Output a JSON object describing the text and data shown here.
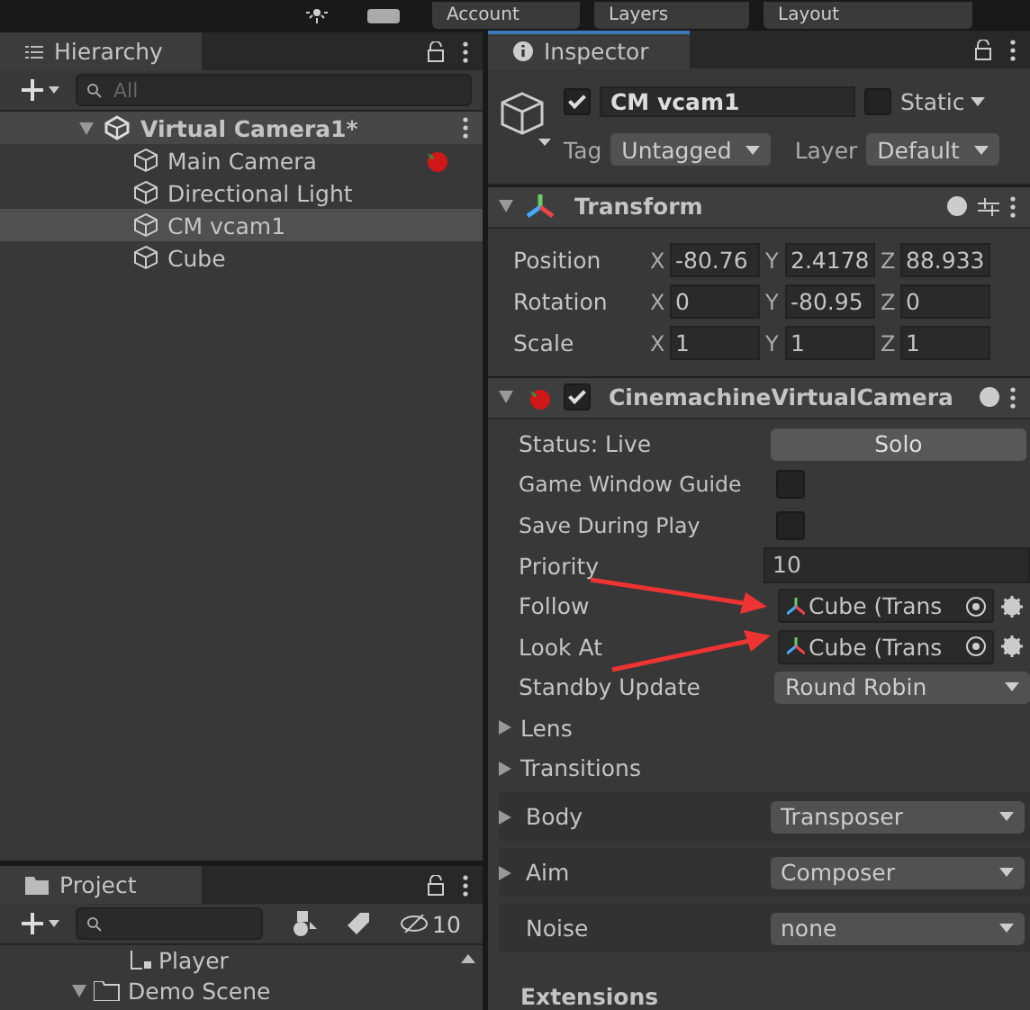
{
  "toolbar": {
    "buttons": [
      {
        "label": "Account"
      },
      {
        "label": "Layers"
      },
      {
        "label": "Layout"
      }
    ]
  },
  "hierarchy": {
    "title": "Hierarchy",
    "search": {
      "placeholder": "All"
    },
    "items": [
      {
        "label": "Virtual Camera1*",
        "expanded": true,
        "children": [
          {
            "label": "Main Camera",
            "selected": false,
            "badge": true
          },
          {
            "label": "Directional Light",
            "selected": false
          },
          {
            "label": "CM vcam1",
            "selected": true
          },
          {
            "label": "Cube",
            "selected": false
          }
        ]
      }
    ]
  },
  "project": {
    "title": "Project",
    "count": "10",
    "items": [
      {
        "label": "Player",
        "kind": "file"
      },
      {
        "label": "Demo Scene",
        "kind": "folder",
        "expanded": true
      }
    ]
  },
  "inspector": {
    "title": "Inspector",
    "object": {
      "active": true,
      "name": "CM vcam1",
      "static": false,
      "static_label": "Static",
      "tag_label": "Tag",
      "tag": "Untagged",
      "layer_label": "Layer",
      "layer": "Default"
    },
    "transform": {
      "title": "Transform",
      "expanded": true,
      "rows": [
        {
          "label": "Position",
          "values": [
            {
              "axis": "X",
              "value": "-80.76"
            },
            {
              "axis": "Y",
              "value": "2.4178"
            },
            {
              "axis": "Z",
              "value": "88.933"
            }
          ]
        },
        {
          "label": "Rotation",
          "values": [
            {
              "axis": "X",
              "value": "0"
            },
            {
              "axis": "Y",
              "value": "-80.95"
            },
            {
              "axis": "Z",
              "value": "0"
            }
          ]
        },
        {
          "label": "Scale",
          "values": [
            {
              "axis": "X",
              "value": "1"
            },
            {
              "axis": "Y",
              "value": "1"
            },
            {
              "axis": "Z",
              "value": "1"
            }
          ]
        }
      ]
    },
    "camera": {
      "title": "CinemachineVirtualCamera",
      "expanded": true,
      "enabled": true,
      "rows": [
        {
          "kind": "button",
          "label": "Status: Live",
          "value": "Solo"
        },
        {
          "kind": "checkbox",
          "label": "Game Window Guide",
          "checked": false
        },
        {
          "kind": "checkbox",
          "label": "Save During Play",
          "checked": false
        },
        {
          "kind": "text",
          "label": "Priority",
          "value": "10"
        },
        {
          "kind": "object",
          "label": "Follow",
          "value": "Cube (Trans"
        },
        {
          "kind": "object",
          "label": "Look At",
          "value": "Cube (Trans"
        },
        {
          "kind": "dropdown",
          "label": "Standby Update",
          "value": "Round Robin"
        },
        {
          "kind": "foldout",
          "label": "Lens",
          "expanded": false
        },
        {
          "kind": "foldout",
          "label": "Transitions",
          "expanded": false
        },
        {
          "kind": "stage",
          "label": "Body",
          "value": "Transposer",
          "expanded": false
        },
        {
          "kind": "stage",
          "label": "Aim",
          "value": "Composer",
          "expanded": false
        },
        {
          "kind": "stage",
          "label": "Noise",
          "value": "none",
          "expandable": false
        },
        {
          "kind": "header",
          "label": "Extensions"
        }
      ]
    }
  }
}
